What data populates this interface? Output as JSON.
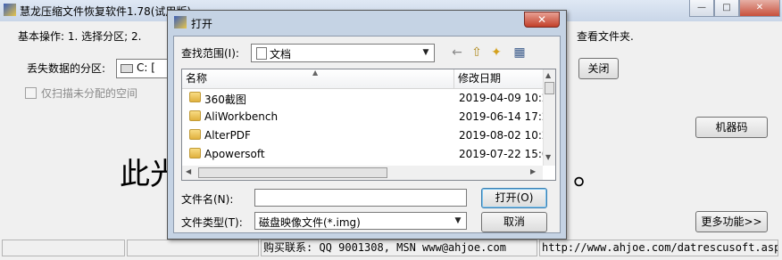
{
  "window": {
    "title": "慧龙压缩文件恢复软件1.78(试用版)",
    "steps_text": "基本操作: 1. 选择分区; 2.",
    "steps_tail": "查看文件夹.",
    "partition_label": "丢失数据的分区:",
    "partition_value": "C: [",
    "scan_unallocated_label": "仅扫描未分配的空间",
    "close_label": "关闭",
    "machine_code_label": "机器码",
    "more_label": "更多功能>>",
    "big_text": "此光",
    "big_text_tail": "。",
    "minimize_glyph": "—",
    "maximize_glyph": "□",
    "close_glyph": "✕"
  },
  "status_bar": {
    "contact": "购买联系: QQ 9001308, MSN www@ahjoe.com",
    "url": "http://www.ahjoe.com/datrescusoft.asp"
  },
  "dialog": {
    "title": "打开",
    "lookin_label": "查找范围(I):",
    "lookin_value": "文档",
    "columns": {
      "name": "名称",
      "date": "修改日期"
    },
    "files": [
      {
        "name": "360截图",
        "date": "2019-04-09 10:2"
      },
      {
        "name": "AliWorkbench",
        "date": "2019-06-14 17:2"
      },
      {
        "name": "AlterPDF",
        "date": "2019-08-02 10:2"
      },
      {
        "name": "Apowersoft",
        "date": "2019-07-22 15:0"
      }
    ],
    "filename_label": "文件名(N):",
    "filename_value": "",
    "filetype_label": "文件类型(T):",
    "filetype_value": "磁盘映像文件(*.img)",
    "open_label": "打开(O)",
    "cancel_label": "取消",
    "close_glyph": "✕"
  },
  "icons": {
    "back": "←",
    "up": "⇧",
    "new_folder": "✦",
    "view": "▦"
  },
  "colors": {
    "dialog_frame": "#c5d3e4",
    "close_button": "#c2402a",
    "folder": "#e0b13e"
  }
}
